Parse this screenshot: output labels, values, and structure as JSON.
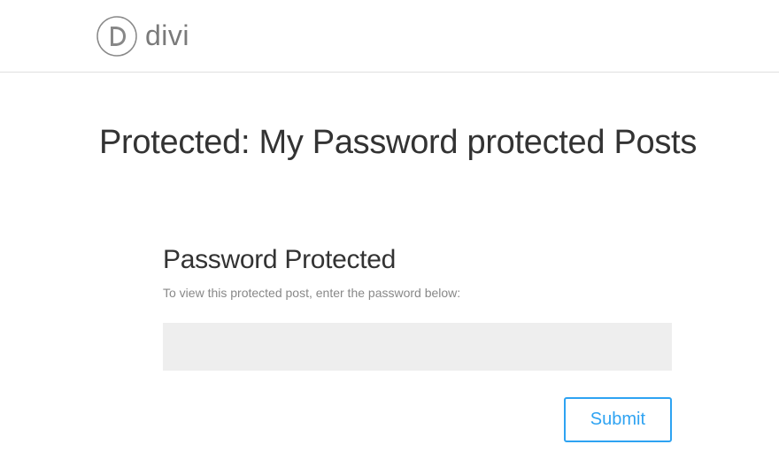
{
  "header": {
    "brand_name": "divi"
  },
  "page": {
    "title": "Protected: My Password protected Posts"
  },
  "form": {
    "heading": "Password Protected",
    "instruction": "To view this protected post, enter the password below:",
    "password_value": "",
    "submit_label": "Submit"
  },
  "colors": {
    "accent": "#2ea3f2",
    "text_dark": "#333333",
    "text_muted": "#888888",
    "input_bg": "#eeeeee",
    "border": "#e0e0e0"
  }
}
